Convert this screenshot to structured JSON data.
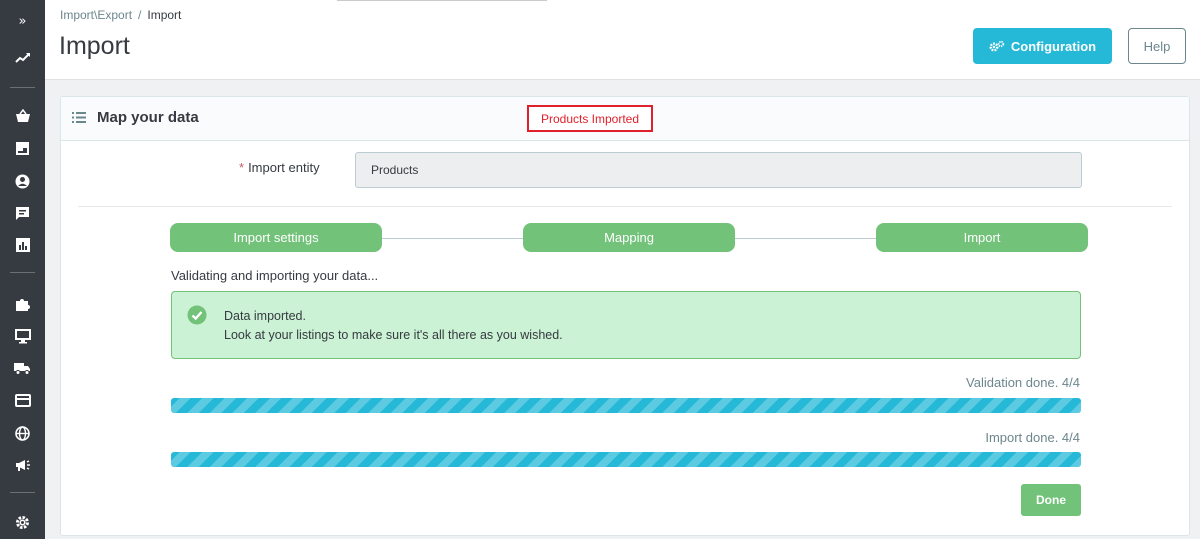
{
  "sidebar": {
    "items": [
      {
        "icon": "expand-icon",
        "glyph": "»"
      },
      {
        "icon": "trend-icon"
      },
      {
        "icon": "basket-icon"
      },
      {
        "icon": "store-icon"
      },
      {
        "icon": "customer-icon"
      },
      {
        "icon": "message-icon"
      },
      {
        "icon": "stats-icon"
      },
      {
        "icon": "puzzle-icon"
      },
      {
        "icon": "monitor-icon"
      },
      {
        "icon": "truck-icon"
      },
      {
        "icon": "card-icon"
      },
      {
        "icon": "globe-icon"
      },
      {
        "icon": "megaphone-icon"
      },
      {
        "icon": "settings-icon"
      }
    ]
  },
  "header": {
    "breadcrumb": [
      "Import\\Export",
      "Import"
    ],
    "breadcrumb_sep": "/",
    "title": "Import",
    "config_button": "Configuration",
    "help_button": "Help"
  },
  "card": {
    "title": "Map your data",
    "annotation": "Products Imported",
    "entity_required": "*",
    "entity_label": "Import entity",
    "entity_value": "Products"
  },
  "steps": [
    "Import settings",
    "Mapping",
    "Import"
  ],
  "status_text": "Validating and importing your data...",
  "alert": {
    "line1": "Data imported.",
    "line2": "Look at your listings to make sure it's all there as you wished."
  },
  "progress": [
    {
      "label": "Validation done. 4/4",
      "fraction": 1.0
    },
    {
      "label": "Import done. 4/4",
      "fraction": 1.0
    }
  ],
  "done_button": "Done",
  "colors": {
    "sidebar": "#363a41",
    "primary": "#25b9d7",
    "success": "#72c279",
    "alert_bg": "#cbf2d4",
    "annotation": "#e0202c"
  }
}
